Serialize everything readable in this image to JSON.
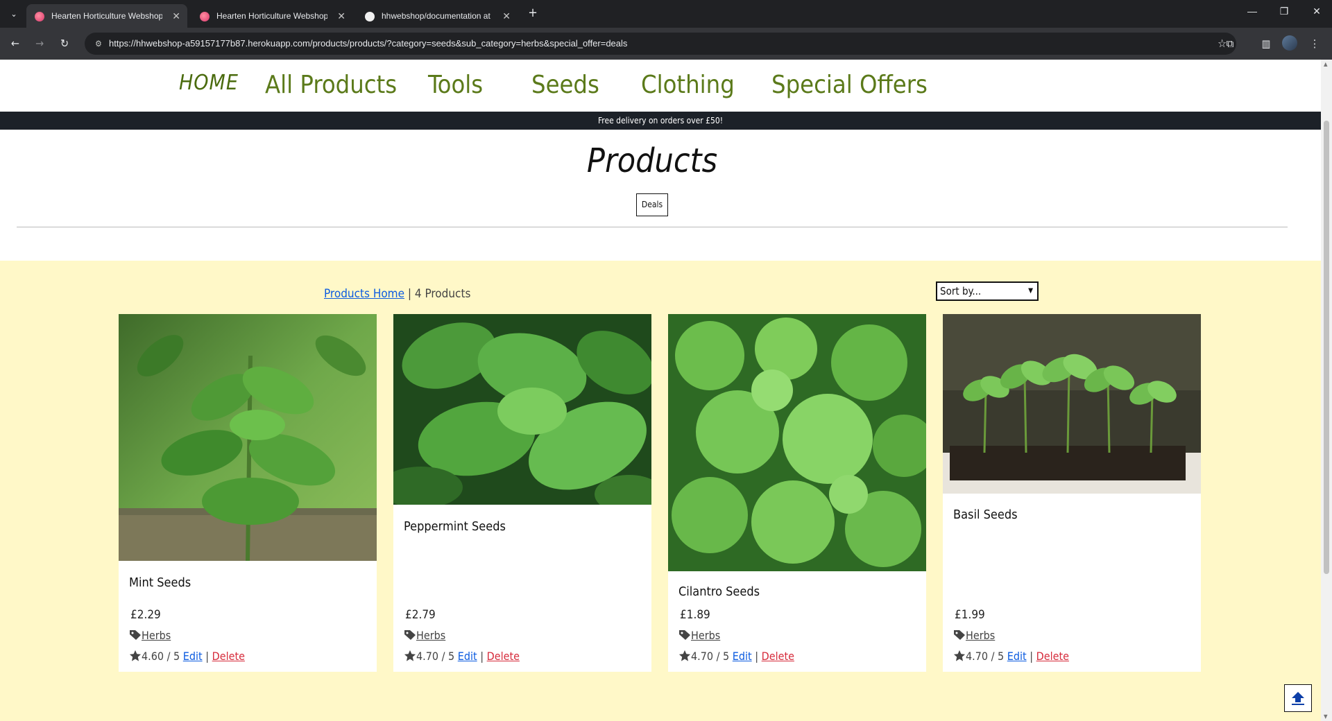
{
  "browser": {
    "tabs": [
      {
        "title": "Hearten Horticulture Webshop",
        "active": true
      },
      {
        "title": "Hearten Horticulture Webshop",
        "active": false
      },
      {
        "title": "hhwebshop/documentation at",
        "active": false
      }
    ],
    "url": "https://hhwebshop-a59157177b87.herokuapp.com/products/products/?category=seeds&sub_category=herbs&special_offer=deals"
  },
  "site_nav": {
    "home": "HOME",
    "links": [
      "All Products",
      "Tools",
      "Seeds",
      "Clothing",
      "Special Offers"
    ]
  },
  "banner": "Free delivery on orders over £50!",
  "page": {
    "title": "Products",
    "filter_badge": "Deals"
  },
  "toolbar": {
    "products_home_link": "Products Home",
    "separator": " | ",
    "product_count": "4 Products",
    "sort_label": "Sort by..."
  },
  "products": [
    {
      "name": "Mint Seeds",
      "price": "£2.29",
      "category": "Herbs",
      "rating": "4.60 / 5",
      "edit": "Edit",
      "delete": "Delete",
      "sep": " | "
    },
    {
      "name": "Peppermint Seeds",
      "price": "£2.79",
      "category": "Herbs",
      "rating": "4.70 / 5",
      "edit": "Edit",
      "delete": "Delete",
      "sep": " | "
    },
    {
      "name": "Cilantro Seeds",
      "price": "£1.89",
      "category": "Herbs",
      "rating": "4.70 / 5",
      "edit": "Edit",
      "delete": "Delete",
      "sep": " | "
    },
    {
      "name": "Basil Seeds",
      "price": "£1.99",
      "category": "Herbs",
      "rating": "4.70 / 5",
      "edit": "Edit",
      "delete": "Delete",
      "sep": " | "
    }
  ],
  "colors": {
    "nav_green": "#5b7a1a",
    "banner_bg": "#1c2128",
    "section_bg": "#fff8c8",
    "link_blue": "#0d5ce0",
    "delete_red": "#d62b3b"
  }
}
